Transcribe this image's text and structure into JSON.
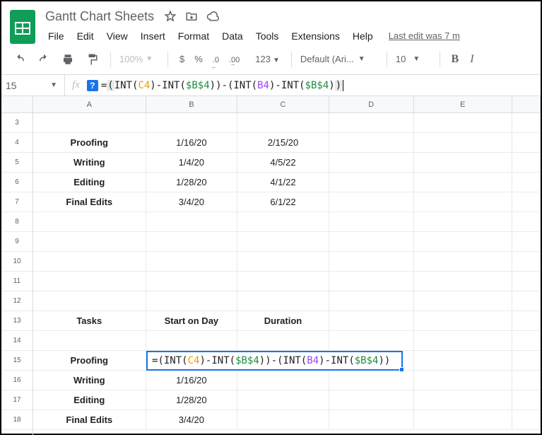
{
  "header": {
    "doc_title": "Gantt Chart Sheets",
    "last_edit": "Last edit was 7 m"
  },
  "menu": {
    "file": "File",
    "edit": "Edit",
    "view": "View",
    "insert": "Insert",
    "format": "Format",
    "data": "Data",
    "tools": "Tools",
    "extensions": "Extensions",
    "help": "Help"
  },
  "toolbar": {
    "zoom": "100%",
    "currency": "$",
    "percent": "%",
    "dec_dec": ".0",
    "dec_inc": ".00",
    "numfmt": "123",
    "font": "Default (Ari...",
    "size": "10",
    "bold": "B",
    "italic": "I"
  },
  "formula_bar": {
    "namebox": "15",
    "fx": "fx",
    "help": "?",
    "eq": "=",
    "lp": "(",
    "rp": ")",
    "fn_int": "INT",
    "ref_c4": "C4",
    "ref_abs": "$B$4",
    "ref_b4": "B4",
    "dash": "-"
  },
  "columns": {
    "A": "A",
    "B": "B",
    "C": "C",
    "D": "D",
    "E": "E",
    "F": ""
  },
  "row_labels": {
    "r3": "3",
    "r4": "4",
    "r5": "5",
    "r6": "6",
    "r7": "7",
    "r8": "8",
    "r9": "9",
    "r10": "10",
    "r11": "11",
    "r12": "12",
    "r13": "13",
    "r14": "14",
    "r15": "15",
    "r16": "16",
    "r17": "17",
    "r18": "18"
  },
  "data1": {
    "r4": {
      "a": "Proofing",
      "b": "1/16/20",
      "c": "2/15/20"
    },
    "r5": {
      "a": "Writing",
      "b": "1/4/20",
      "c": "4/5/22"
    },
    "r6": {
      "a": "Editing",
      "b": "1/28/20",
      "c": "4/1/22"
    },
    "r7": {
      "a": "Final Edits",
      "b": "3/4/20",
      "c": "6/1/22"
    }
  },
  "headers2": {
    "a": "Tasks",
    "b": "Start on Day",
    "c": "Duration"
  },
  "data2": {
    "r15": {
      "a": "Proofing",
      "b": ""
    },
    "r16": {
      "a": "Writing",
      "b": "1/16/20"
    },
    "r17": {
      "a": "Editing",
      "b": "1/28/20"
    },
    "r18": {
      "a": "Final Edits",
      "b": "3/4/20"
    }
  }
}
